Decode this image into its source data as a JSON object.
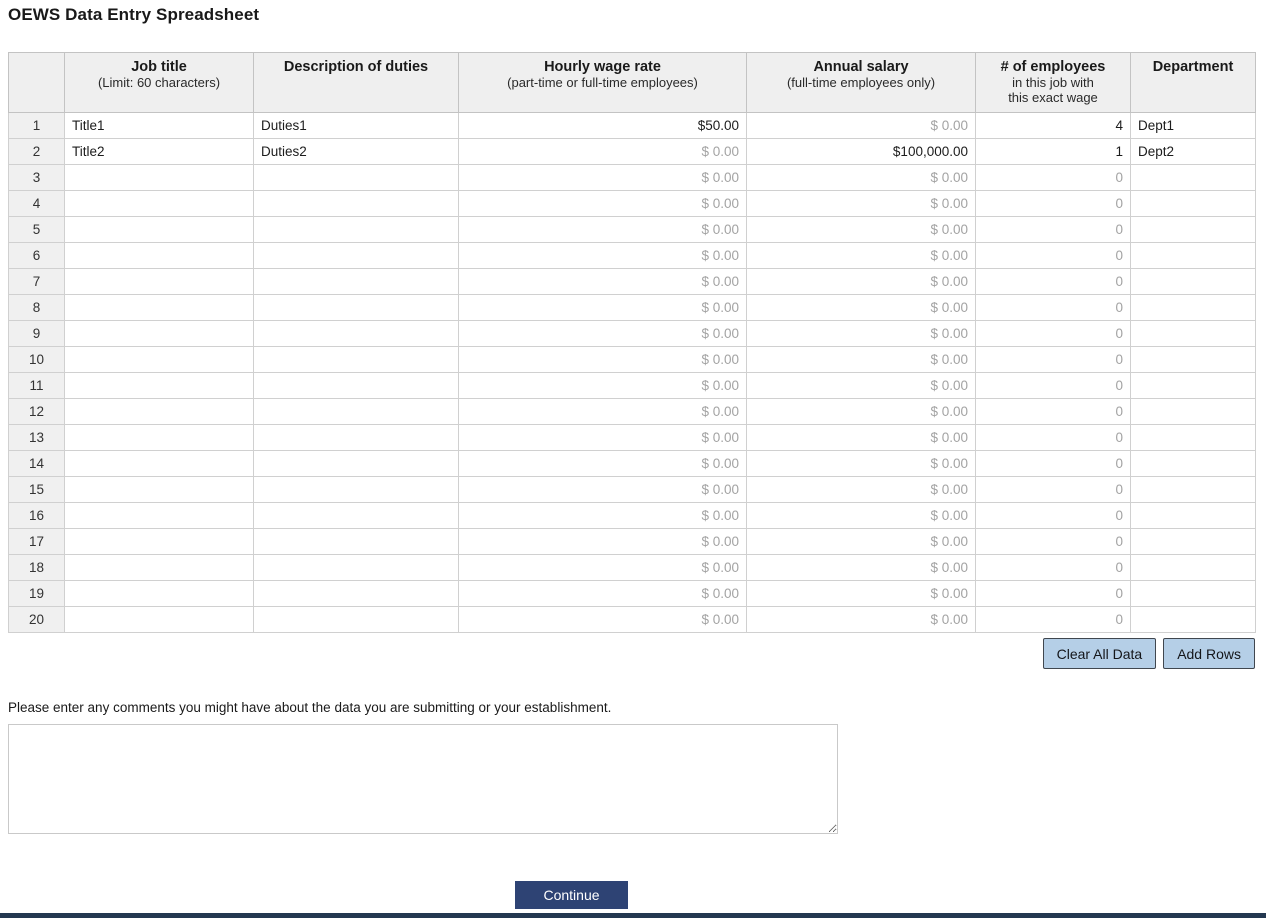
{
  "page": {
    "title": "OEWS Data Entry Spreadsheet"
  },
  "table": {
    "headers": {
      "job_title": {
        "main": "Job title",
        "sub": "(Limit: 60 characters)"
      },
      "duties": {
        "main": "Description of duties",
        "sub": ""
      },
      "hourly": {
        "main": "Hourly wage rate",
        "sub": "(part-time or full-time employees)"
      },
      "annual": {
        "main": "Annual salary",
        "sub": "(full-time employees only)"
      },
      "employees": {
        "main": "# of employees",
        "sub": "in this job with",
        "sub2": "this exact wage"
      },
      "department": {
        "main": "Department",
        "sub": ""
      }
    },
    "rows": [
      {
        "num": "1",
        "job_title": "Title1",
        "duties": "Duties1",
        "hourly": "$50.00",
        "hourly_muted": false,
        "annual": "$ 0.00",
        "annual_muted": true,
        "employees": "4",
        "employees_muted": false,
        "department": "Dept1"
      },
      {
        "num": "2",
        "job_title": "Title2",
        "duties": "Duties2",
        "hourly": "$ 0.00",
        "hourly_muted": true,
        "annual": "$100,000.00",
        "annual_muted": false,
        "employees": "1",
        "employees_muted": false,
        "department": "Dept2"
      },
      {
        "num": "3",
        "job_title": "",
        "duties": "",
        "hourly": "$ 0.00",
        "hourly_muted": true,
        "annual": "$ 0.00",
        "annual_muted": true,
        "employees": "0",
        "employees_muted": true,
        "department": ""
      },
      {
        "num": "4",
        "job_title": "",
        "duties": "",
        "hourly": "$ 0.00",
        "hourly_muted": true,
        "annual": "$ 0.00",
        "annual_muted": true,
        "employees": "0",
        "employees_muted": true,
        "department": ""
      },
      {
        "num": "5",
        "job_title": "",
        "duties": "",
        "hourly": "$ 0.00",
        "hourly_muted": true,
        "annual": "$ 0.00",
        "annual_muted": true,
        "employees": "0",
        "employees_muted": true,
        "department": ""
      },
      {
        "num": "6",
        "job_title": "",
        "duties": "",
        "hourly": "$ 0.00",
        "hourly_muted": true,
        "annual": "$ 0.00",
        "annual_muted": true,
        "employees": "0",
        "employees_muted": true,
        "department": ""
      },
      {
        "num": "7",
        "job_title": "",
        "duties": "",
        "hourly": "$ 0.00",
        "hourly_muted": true,
        "annual": "$ 0.00",
        "annual_muted": true,
        "employees": "0",
        "employees_muted": true,
        "department": ""
      },
      {
        "num": "8",
        "job_title": "",
        "duties": "",
        "hourly": "$ 0.00",
        "hourly_muted": true,
        "annual": "$ 0.00",
        "annual_muted": true,
        "employees": "0",
        "employees_muted": true,
        "department": ""
      },
      {
        "num": "9",
        "job_title": "",
        "duties": "",
        "hourly": "$ 0.00",
        "hourly_muted": true,
        "annual": "$ 0.00",
        "annual_muted": true,
        "employees": "0",
        "employees_muted": true,
        "department": ""
      },
      {
        "num": "10",
        "job_title": "",
        "duties": "",
        "hourly": "$ 0.00",
        "hourly_muted": true,
        "annual": "$ 0.00",
        "annual_muted": true,
        "employees": "0",
        "employees_muted": true,
        "department": ""
      },
      {
        "num": "11",
        "job_title": "",
        "duties": "",
        "hourly": "$ 0.00",
        "hourly_muted": true,
        "annual": "$ 0.00",
        "annual_muted": true,
        "employees": "0",
        "employees_muted": true,
        "department": ""
      },
      {
        "num": "12",
        "job_title": "",
        "duties": "",
        "hourly": "$ 0.00",
        "hourly_muted": true,
        "annual": "$ 0.00",
        "annual_muted": true,
        "employees": "0",
        "employees_muted": true,
        "department": ""
      },
      {
        "num": "13",
        "job_title": "",
        "duties": "",
        "hourly": "$ 0.00",
        "hourly_muted": true,
        "annual": "$ 0.00",
        "annual_muted": true,
        "employees": "0",
        "employees_muted": true,
        "department": ""
      },
      {
        "num": "14",
        "job_title": "",
        "duties": "",
        "hourly": "$ 0.00",
        "hourly_muted": true,
        "annual": "$ 0.00",
        "annual_muted": true,
        "employees": "0",
        "employees_muted": true,
        "department": ""
      },
      {
        "num": "15",
        "job_title": "",
        "duties": "",
        "hourly": "$ 0.00",
        "hourly_muted": true,
        "annual": "$ 0.00",
        "annual_muted": true,
        "employees": "0",
        "employees_muted": true,
        "department": ""
      },
      {
        "num": "16",
        "job_title": "",
        "duties": "",
        "hourly": "$ 0.00",
        "hourly_muted": true,
        "annual": "$ 0.00",
        "annual_muted": true,
        "employees": "0",
        "employees_muted": true,
        "department": ""
      },
      {
        "num": "17",
        "job_title": "",
        "duties": "",
        "hourly": "$ 0.00",
        "hourly_muted": true,
        "annual": "$ 0.00",
        "annual_muted": true,
        "employees": "0",
        "employees_muted": true,
        "department": ""
      },
      {
        "num": "18",
        "job_title": "",
        "duties": "",
        "hourly": "$ 0.00",
        "hourly_muted": true,
        "annual": "$ 0.00",
        "annual_muted": true,
        "employees": "0",
        "employees_muted": true,
        "department": ""
      },
      {
        "num": "19",
        "job_title": "",
        "duties": "",
        "hourly": "$ 0.00",
        "hourly_muted": true,
        "annual": "$ 0.00",
        "annual_muted": true,
        "employees": "0",
        "employees_muted": true,
        "department": ""
      },
      {
        "num": "20",
        "job_title": "",
        "duties": "",
        "hourly": "$ 0.00",
        "hourly_muted": true,
        "annual": "$ 0.00",
        "annual_muted": true,
        "employees": "0",
        "employees_muted": true,
        "department": ""
      }
    ]
  },
  "buttons": {
    "clear_all": "Clear All Data",
    "add_rows": "Add Rows",
    "continue_label": "Continue"
  },
  "comments": {
    "label": "Please enter any comments you might have about the data you are submitting or your establishment.",
    "value": ""
  }
}
